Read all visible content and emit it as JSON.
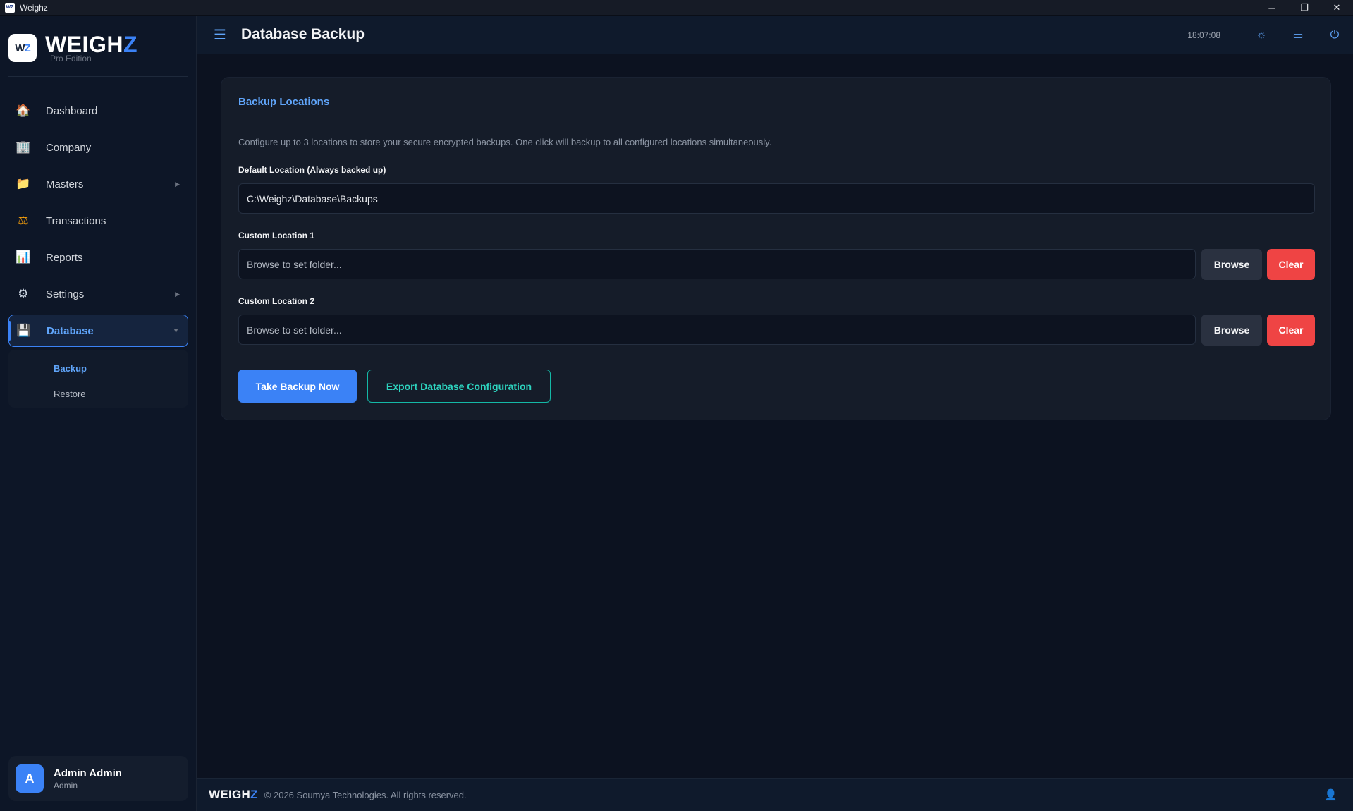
{
  "window": {
    "title": "Weighz",
    "app_icon_text": "WZ",
    "minimize": "─",
    "restore": "❐",
    "close": "✕"
  },
  "brand": {
    "logo_w": "W",
    "logo_z": "Z",
    "name_main": "WEIGH",
    "name_accent": "Z",
    "edition": "Pro Edition"
  },
  "sidebar": {
    "items": [
      {
        "label": "Dashboard",
        "icon": "🏠"
      },
      {
        "label": "Company",
        "icon": "🏢"
      },
      {
        "label": "Masters",
        "icon": "📁",
        "arrow": "▶"
      },
      {
        "label": "Transactions",
        "icon": "⚖"
      },
      {
        "label": "Reports",
        "icon": "📊"
      },
      {
        "label": "Settings",
        "icon": "⚙",
        "arrow": "▶"
      },
      {
        "label": "Database",
        "icon": "💾",
        "arrow": "▼"
      }
    ],
    "subitems": [
      {
        "label": "Backup"
      },
      {
        "label": "Restore"
      }
    ]
  },
  "user": {
    "initial": "A",
    "name": "Admin Admin",
    "role": "Admin"
  },
  "header": {
    "menu_icon": "☰",
    "title": "Database Backup",
    "clock": "18:07:08",
    "theme_icon": "☼",
    "window_icon": "▭",
    "power_icon": "⏻"
  },
  "card": {
    "title": "Backup Locations",
    "description": "Configure up to 3 locations to store your secure encrypted backups. One click will backup to all configured locations simultaneously.",
    "default_label": "Default Location (Always backed up)",
    "default_value": "C:\\Weighz\\Database\\Backups",
    "custom1_label": "Custom Location 1",
    "custom1_placeholder": "Browse to set folder...",
    "custom2_label": "Custom Location 2",
    "custom2_placeholder": "Browse to set folder...",
    "browse_label": "Browse",
    "clear_label": "Clear",
    "backup_now_label": "Take Backup Now",
    "export_label": "Export Database Configuration"
  },
  "footer": {
    "brand_main": "WEIGH",
    "brand_accent": "Z",
    "copyright": "© 2026 Soumya Technologies. All rights reserved.",
    "support_icon": "👤"
  },
  "colors": {
    "accent": "#3b82f6",
    "danger": "#ef4444",
    "teal": "#14b8a6",
    "background": "#0c1220"
  }
}
